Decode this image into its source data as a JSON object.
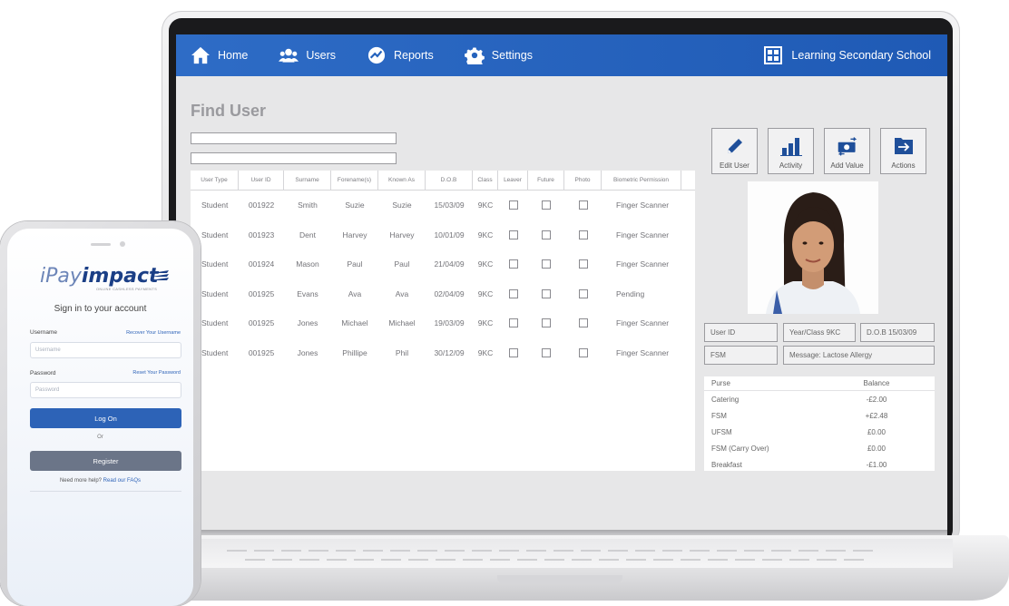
{
  "nav": {
    "items": [
      {
        "label": "Home",
        "icon": "home-icon"
      },
      {
        "label": "Users",
        "icon": "users-icon"
      },
      {
        "label": "Reports",
        "icon": "reports-icon"
      },
      {
        "label": "Settings",
        "icon": "gear-icon"
      }
    ],
    "school": "Learning Secondary School"
  },
  "page": {
    "title": "Find User"
  },
  "table": {
    "headers": [
      "User Type",
      "User ID",
      "Surname",
      "Forename(s)",
      "Known As",
      "D.O.B",
      "Class",
      "Leaver",
      "Future",
      "Photo",
      "Biometric Permission"
    ],
    "rows": [
      {
        "type": "Student",
        "id": "001922",
        "surname": "Smith",
        "forename": "Suzie",
        "known": "Suzie",
        "dob": "15/03/09",
        "class": "9KC",
        "bio": "Finger Scanner"
      },
      {
        "type": "Student",
        "id": "001923",
        "surname": "Dent",
        "forename": "Harvey",
        "known": "Harvey",
        "dob": "10/01/09",
        "class": "9KC",
        "bio": "Finger Scanner"
      },
      {
        "type": "Student",
        "id": "001924",
        "surname": "Mason",
        "forename": "Paul",
        "known": "Paul",
        "dob": "21/04/09",
        "class": "9KC",
        "bio": "Finger Scanner"
      },
      {
        "type": "Student",
        "id": "001925",
        "surname": "Evans",
        "forename": "Ava",
        "known": "Ava",
        "dob": "02/04/09",
        "class": "9KC",
        "bio": "Pending"
      },
      {
        "type": "Student",
        "id": "001925",
        "surname": "Jones",
        "forename": "Michael",
        "known": "Michael",
        "dob": "19/03/09",
        "class": "9KC",
        "bio": "Finger Scanner"
      },
      {
        "type": "Student",
        "id": "001925",
        "surname": "Jones",
        "forename": "Phillipe",
        "known": "Phil",
        "dob": "30/12/09",
        "class": "9KC",
        "bio": "Finger Scanner"
      }
    ]
  },
  "actions": [
    {
      "label": "Edit User",
      "icon": "pencil-icon"
    },
    {
      "label": "Activity",
      "icon": "bar-chart-icon"
    },
    {
      "label": "Add Value",
      "icon": "money-icon"
    },
    {
      "label": "Actions",
      "icon": "arrow-right-icon"
    }
  ],
  "details": {
    "user_id": "User ID",
    "year_class": "Year/Class  9KC",
    "dob": "D.O.B  15/03/09",
    "fsm": "FSM",
    "message": "Message: Lactose Allergy"
  },
  "purse": {
    "headers": [
      "Purse",
      "Balance"
    ],
    "rows": [
      {
        "name": "Catering",
        "balance": "-£2.00"
      },
      {
        "name": "FSM",
        "balance": "+£2.48"
      },
      {
        "name": "UFSM",
        "balance": "£0.00"
      },
      {
        "name": "FSM (Carry Over)",
        "balance": "£0.00"
      },
      {
        "name": "Breakfast",
        "balance": "-£1.00"
      }
    ]
  },
  "phone": {
    "logo_a": "iPay",
    "logo_b": "impact",
    "logo_sub": "ONLINE CASHLESS PAYMENTS",
    "title": "Sign in to your account",
    "username_label": "Username",
    "recover_link": "Recover Your Username",
    "username_placeholder": "Username",
    "password_label": "Password",
    "reset_link": "Reset Your Password",
    "password_placeholder": "Password",
    "logon": "Log On",
    "or": "Or",
    "register": "Register",
    "help_text": "Need more help?",
    "faq_link": "Read our FAQs"
  },
  "colors": {
    "nav": "#2563bd",
    "logon": "#2d63b7",
    "register": "#6b7588"
  }
}
